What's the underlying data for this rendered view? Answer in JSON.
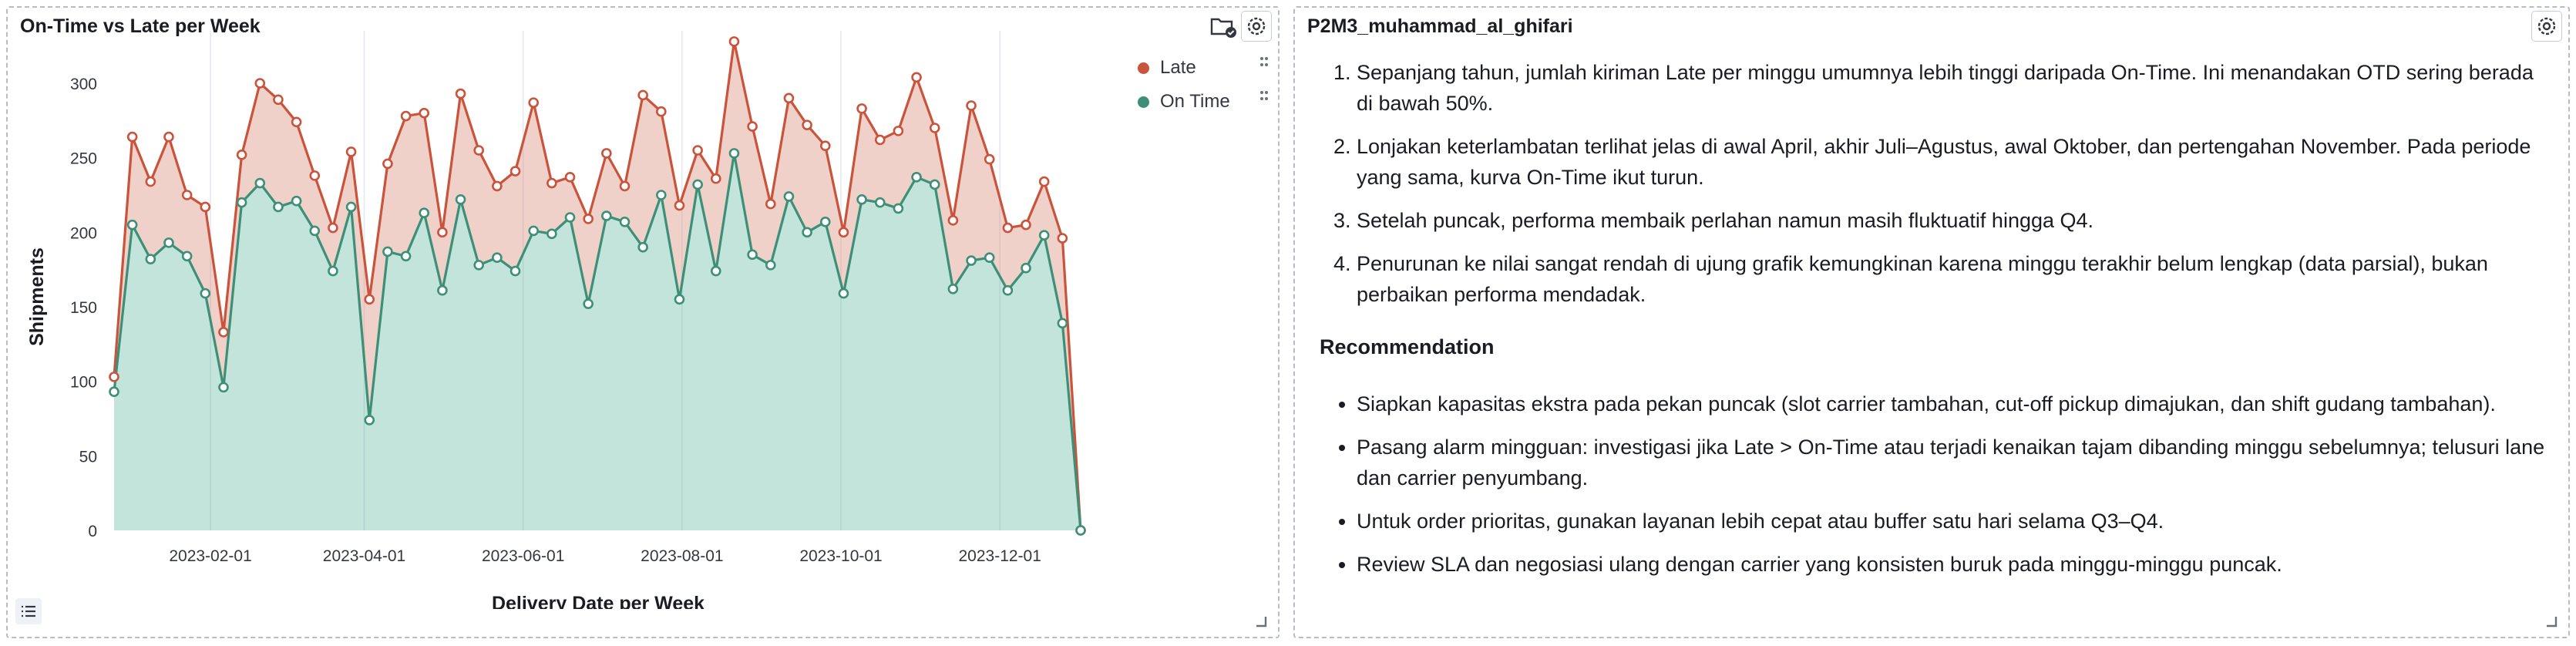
{
  "chart_panel": {
    "title": "On-Time vs Late per Week",
    "icons": [
      "folder-check-icon",
      "gear-icon",
      "list-icon",
      "resize-handle-icon"
    ]
  },
  "text_panel": {
    "title": "P2M3_muhammad_al_ghifari",
    "insights": [
      "Sepanjang tahun, jumlah kiriman Late per minggu umumnya lebih tinggi daripada On-Time. Ini menandakan OTD sering berada di bawah 50%.",
      "Lonjakan keterlambatan terlihat jelas di awal April, akhir Juli–Agustus, awal Oktober, dan pertengahan November. Pada periode yang sama, kurva On-Time ikut turun.",
      "Setelah puncak, performa membaik perlahan namun masih fluktuatif hingga Q4.",
      "Penurunan ke nilai sangat rendah di ujung grafik kemungkinan karena minggu terakhir belum lengkap (data parsial), bukan perbaikan performa mendadak."
    ],
    "recommendation_heading": "Recommendation",
    "recommendations": [
      "Siapkan kapasitas ekstra pada pekan puncak (slot carrier tambahan, cut-off pickup dimajukan, dan shift gudang tambahan).",
      "Pasang alarm mingguan: investigasi jika Late > On-Time atau terjadi kenaikan tajam dibanding minggu sebelumnya; telusuri lane dan carrier penyumbang.",
      "Untuk order prioritas, gunakan layanan lebih cepat atau buffer satu hari selama Q3–Q4.",
      "Review SLA dan negosiasi ulang dengan carrier yang konsisten buruk pada minggu-minggu puncak."
    ]
  },
  "chart_data": {
    "type": "area",
    "title": "On-Time vs Late per Week",
    "xlabel": "Delivery Date per Week",
    "ylabel": "Shipments",
    "ylim": [
      0,
      330
    ],
    "yticks": [
      0,
      50,
      100,
      150,
      200,
      250,
      300
    ],
    "x_start": "2022-12-26",
    "x_step_days": 7,
    "xticks": [
      "2023-02-01",
      "2023-04-01",
      "2023-06-01",
      "2023-08-01",
      "2023-10-01",
      "2023-12-01"
    ],
    "stacked": true,
    "grid": true,
    "legend": "top-right",
    "series": [
      {
        "name": "On Time",
        "color": "#54b399",
        "line_color": "#3d8f77",
        "values": [
          93,
          205,
          182,
          193,
          184,
          159,
          96,
          220,
          233,
          217,
          221,
          201,
          174,
          217,
          74,
          187,
          184,
          213,
          161,
          222,
          178,
          183,
          174,
          201,
          199,
          210,
          152,
          211,
          207,
          190,
          225,
          155,
          232,
          174,
          253,
          185,
          178,
          224,
          200,
          207,
          159,
          222,
          220,
          216,
          237,
          232,
          162,
          181,
          183,
          161,
          176,
          198,
          139,
          0
        ]
      },
      {
        "name": "Late",
        "color": "#da8b7a",
        "line_color": "#c9533b",
        "values": [
          10,
          59,
          52,
          71,
          41,
          58,
          37,
          32,
          67,
          72,
          53,
          37,
          29,
          37,
          81,
          59,
          94,
          67,
          39,
          71,
          77,
          48,
          67,
          86,
          34,
          27,
          57,
          42,
          24,
          102,
          56,
          63,
          23,
          62,
          75,
          86,
          41,
          66,
          72,
          51,
          41,
          61,
          42,
          52,
          67,
          38,
          46,
          104,
          66,
          42,
          29,
          36,
          57,
          0
        ]
      }
    ]
  }
}
